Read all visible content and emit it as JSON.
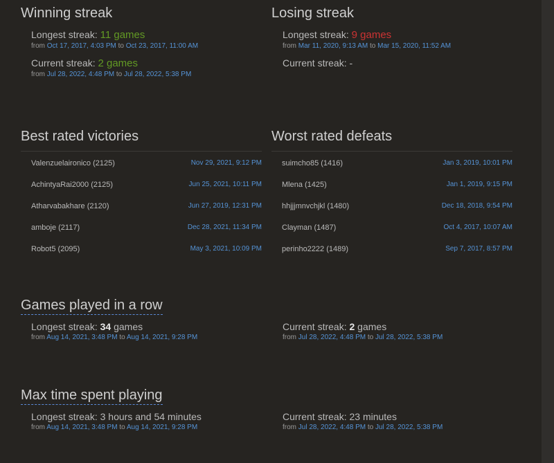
{
  "winning": {
    "title": "Winning streak",
    "longest_label": "Longest streak:",
    "longest_value": "11",
    "longest_unit": "games",
    "longest_from": "Oct 17, 2017, 4:03 PM",
    "longest_to": "Oct 23, 2017, 11:00 AM",
    "current_label": "Current streak:",
    "current_value": "2",
    "current_unit": "games",
    "current_from": "Jul 28, 2022, 4:48 PM",
    "current_to": "Jul 28, 2022, 5:38 PM"
  },
  "losing": {
    "title": "Losing streak",
    "longest_label": "Longest streak:",
    "longest_value": "9",
    "longest_unit": "games",
    "longest_from": "Mar 11, 2020, 9:13 AM",
    "longest_to": "Mar 15, 2020, 11:52 AM",
    "current_text": "Current streak: -"
  },
  "from_word": "from",
  "to_word": "to",
  "victories": {
    "title": "Best rated victories",
    "rows": [
      {
        "user": "Valenzuelaironico (2125)",
        "date": "Nov 29, 2021, 9:12 PM"
      },
      {
        "user": "AchintyaRai2000 (2125)",
        "date": "Jun 25, 2021, 10:11 PM"
      },
      {
        "user": "Atharvabakhare (2120)",
        "date": "Jun 27, 2019, 12:31 PM"
      },
      {
        "user": "amboje (2117)",
        "date": "Dec 28, 2021, 11:34 PM"
      },
      {
        "user": "Robot5 (2095)",
        "date": "May 3, 2021, 10:09 PM"
      }
    ]
  },
  "defeats": {
    "title": "Worst rated defeats",
    "rows": [
      {
        "user": "suimcho85 (1416)",
        "date": "Jan 3, 2019, 10:01 PM"
      },
      {
        "user": "Mlena (1425)",
        "date": "Jan 1, 2019, 9:15 PM"
      },
      {
        "user": "hhjjjmnvchjkl (1480)",
        "date": "Dec 18, 2018, 9:54 PM"
      },
      {
        "user": "Clayman (1487)",
        "date": "Oct 4, 2017, 10:07 AM"
      },
      {
        "user": "perinho2222 (1489)",
        "date": "Sep 7, 2017, 8:57 PM"
      }
    ]
  },
  "in_a_row": {
    "title": "Games played in a row",
    "longest_label": "Longest streak:",
    "longest_value": "34",
    "longest_unit": "games",
    "longest_from": "Aug 14, 2021, 3:48 PM",
    "longest_to": "Aug 14, 2021, 9:28 PM",
    "current_label": "Current streak:",
    "current_value": "2",
    "current_unit": "games",
    "current_from": "Jul 28, 2022, 4:48 PM",
    "current_to": "Jul 28, 2022, 5:38 PM"
  },
  "max_time": {
    "title": "Max time spent playing",
    "longest_text": "Longest streak: 3 hours and 54 minutes",
    "longest_from": "Aug 14, 2021, 3:48 PM",
    "longest_to": "Aug 14, 2021, 9:28 PM",
    "current_text": "Current streak: 23 minutes",
    "current_from": "Jul 28, 2022, 4:48 PM",
    "current_to": "Jul 28, 2022, 5:38 PM"
  },
  "colors": {
    "background": "#262421",
    "win_accent": "#629924",
    "loss_accent": "#cc3333",
    "link": "#5593d6"
  }
}
